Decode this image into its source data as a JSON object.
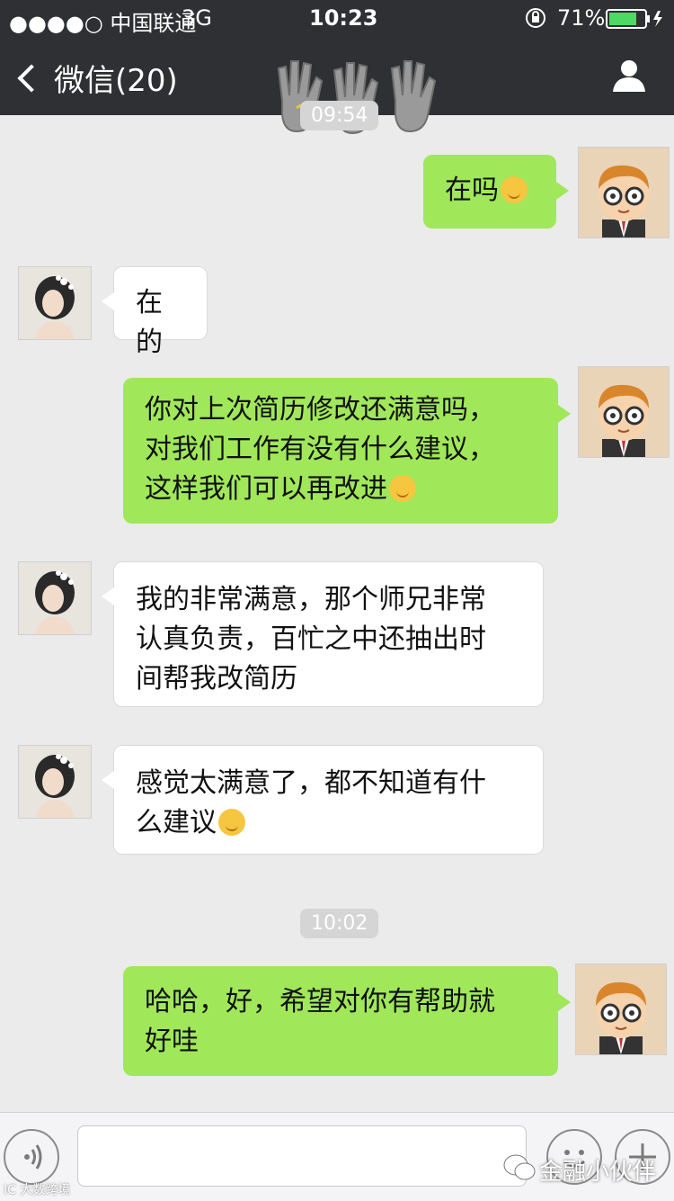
{
  "status_bar": {
    "carrier": "●●●●○ 中国联通",
    "network": "3G",
    "time": "10:23",
    "battery": "71%"
  },
  "nav": {
    "back_label": "微信(20)"
  },
  "timestamps": [
    "09:54",
    "10:02"
  ],
  "messages": [
    {
      "side": "me",
      "lines": [
        "在吗"
      ],
      "emoji": "smile-emoji"
    },
    {
      "side": "them",
      "lines": [
        "在的"
      ]
    },
    {
      "side": "me",
      "lines": [
        "你对上次简历修改还满意吗，",
        "对我们工作有没有什么建议，",
        "这样我们可以再改进"
      ],
      "emoji": "thinking-emoji"
    },
    {
      "side": "them",
      "lines": [
        "我的非常满意，那个师兄非常",
        "认真负责，百忙之中还抽出时",
        "间帮我改简历"
      ]
    },
    {
      "side": "them",
      "lines": [
        "感觉太满意了，都不知道有什",
        "么建议"
      ],
      "emoji": "thinking-emoji"
    },
    {
      "side": "me",
      "lines": [
        "哈哈，好，希望对你有帮助就",
        "好哇"
      ]
    }
  ],
  "watermark": {
    "text": "金融小伙伴",
    "small": "IC 大数跨境"
  },
  "colors": {
    "header": "#2e3033",
    "chat_bg": "#ebebeb",
    "my_bubble": "#a0e75a",
    "their_bubble": "#ffffff"
  }
}
